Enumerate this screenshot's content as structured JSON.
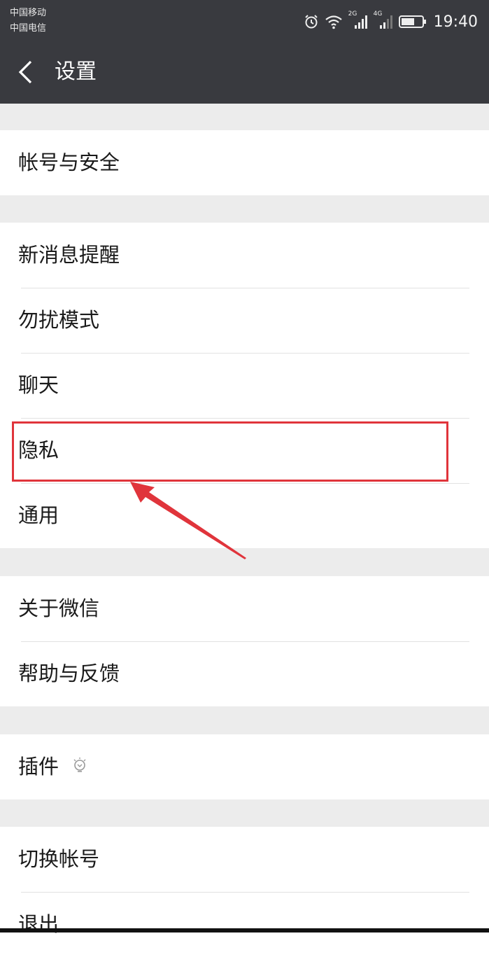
{
  "status_bar": {
    "carrier_1": "中国移动",
    "carrier_2": "中国电信",
    "network_1": "2G",
    "network_2": "4G",
    "time": "19:40",
    "icons": [
      "alarm-icon",
      "wifi-icon",
      "signal-icon",
      "signal-icon",
      "battery-icon"
    ]
  },
  "nav": {
    "title": "设置",
    "back_icon": "chevron-left-icon"
  },
  "groups": [
    {
      "items": [
        {
          "label": "帐号与安全"
        }
      ]
    },
    {
      "items": [
        {
          "label": "新消息提醒"
        },
        {
          "label": "勿扰模式"
        },
        {
          "label": "聊天"
        },
        {
          "label": "隐私"
        },
        {
          "label": "通用"
        }
      ]
    },
    {
      "items": [
        {
          "label": "关于微信"
        },
        {
          "label": "帮助与反馈"
        }
      ]
    },
    {
      "items": [
        {
          "label": "插件",
          "icon": "lightbulb-icon"
        }
      ]
    },
    {
      "items": [
        {
          "label": "切换帐号"
        },
        {
          "label": "退出"
        }
      ]
    }
  ],
  "annotation": {
    "highlighted_item": "隐私",
    "highlight_color": "#e0343b"
  },
  "colors": {
    "header_bg": "#393a3f",
    "page_bg": "#ececec"
  }
}
